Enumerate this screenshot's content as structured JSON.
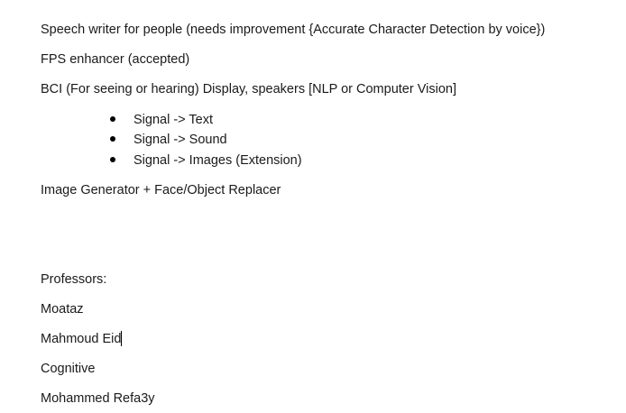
{
  "document": {
    "paragraphs": [
      "Speech writer for people (needs improvement {Accurate Character Detection by voice})",
      "FPS enhancer (accepted)",
      "BCI (For seeing or hearing) Display, speakers [NLP or Computer Vision]"
    ],
    "bullets": [
      "Signal -> Text",
      "Signal -> Sound",
      "Signal -> Images (Extension)"
    ],
    "after_bullets": "Image Generator + Face/Object Replacer",
    "professors_heading": "Professors:",
    "professors": [
      "Moataz",
      "Mahmoud Eid",
      "Cognitive",
      "Mohammed Refa3y"
    ]
  }
}
